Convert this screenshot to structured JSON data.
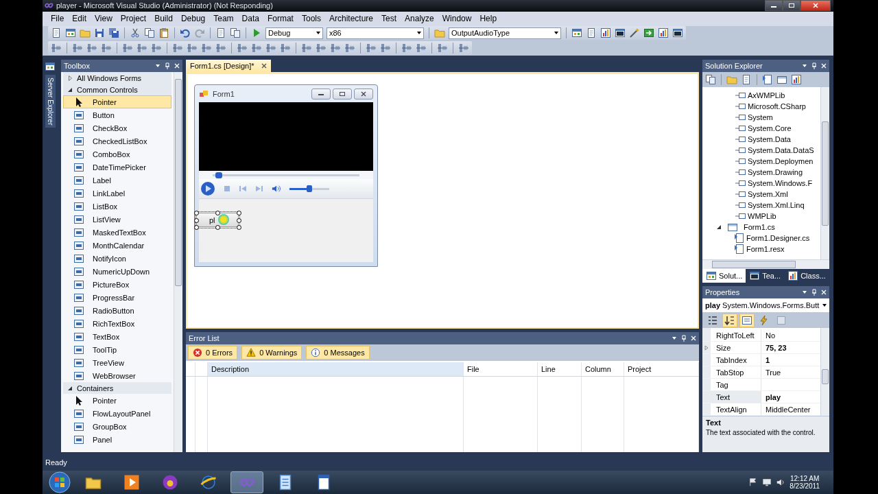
{
  "window": {
    "title": "player - Microsoft Visual Studio (Administrator) (Not Responding)"
  },
  "menu": [
    "File",
    "Edit",
    "View",
    "Project",
    "Build",
    "Debug",
    "Team",
    "Data",
    "Format",
    "Tools",
    "Architecture",
    "Test",
    "Analyze",
    "Window",
    "Help"
  ],
  "toolbar": {
    "configuration": "Debug",
    "platform": "x86",
    "find": "OutputAudioType"
  },
  "server_explorer": {
    "label": "Server Explorer"
  },
  "toolbox": {
    "title": "Toolbox",
    "groups": [
      {
        "label": "All Windows Forms",
        "expanded": false
      },
      {
        "label": "Common Controls",
        "expanded": true,
        "items": [
          {
            "label": "Pointer",
            "kind": "pointer",
            "selected": true
          },
          {
            "label": "Button",
            "kind": "control",
            "selected": false
          },
          {
            "label": "CheckBox",
            "kind": "control",
            "selected": false
          },
          {
            "label": "CheckedListBox",
            "kind": "control",
            "selected": false
          },
          {
            "label": "ComboBox",
            "kind": "control",
            "selected": false
          },
          {
            "label": "DateTimePicker",
            "kind": "control",
            "selected": false
          },
          {
            "label": "Label",
            "kind": "control",
            "selected": false
          },
          {
            "label": "LinkLabel",
            "kind": "control",
            "selected": false
          },
          {
            "label": "ListBox",
            "kind": "control",
            "selected": false
          },
          {
            "label": "ListView",
            "kind": "control",
            "selected": false
          },
          {
            "label": "MaskedTextBox",
            "kind": "control",
            "selected": false
          },
          {
            "label": "MonthCalendar",
            "kind": "control",
            "selected": false
          },
          {
            "label": "NotifyIcon",
            "kind": "control",
            "selected": false
          },
          {
            "label": "NumericUpDown",
            "kind": "control",
            "selected": false
          },
          {
            "label": "PictureBox",
            "kind": "control",
            "selected": false
          },
          {
            "label": "ProgressBar",
            "kind": "control",
            "selected": false
          },
          {
            "label": "RadioButton",
            "kind": "control",
            "selected": false
          },
          {
            "label": "RichTextBox",
            "kind": "control",
            "selected": false
          },
          {
            "label": "TextBox",
            "kind": "control",
            "selected": false
          },
          {
            "label": "ToolTip",
            "kind": "control",
            "selected": false
          },
          {
            "label": "TreeView",
            "kind": "control",
            "selected": false
          },
          {
            "label": "WebBrowser",
            "kind": "control",
            "selected": false
          }
        ]
      },
      {
        "label": "Containers",
        "expanded": true,
        "items": [
          {
            "label": "Pointer",
            "kind": "pointer",
            "selected": false
          },
          {
            "label": "FlowLayoutPanel",
            "kind": "control",
            "selected": false
          },
          {
            "label": "GroupBox",
            "kind": "control",
            "selected": false
          },
          {
            "label": "Panel",
            "kind": "control",
            "selected": false
          }
        ]
      }
    ]
  },
  "document_tab": {
    "label": "Form1.cs [Design]*",
    "selected": true
  },
  "form": {
    "title": "Form1",
    "player": {
      "seek": {
        "level": 0.04
      },
      "volume": {
        "level": 0.5
      }
    },
    "button": {
      "text": "pl",
      "selected": true
    }
  },
  "error_list": {
    "title": "Error List",
    "filters": [
      {
        "label": "0 Errors",
        "kind": "error",
        "selected": true
      },
      {
        "label": "0 Warnings",
        "kind": "warning",
        "selected": true
      },
      {
        "label": "0 Messages",
        "kind": "info",
        "selected": true
      }
    ],
    "columns": [
      "Description",
      "File",
      "Line",
      "Column",
      "Project"
    ]
  },
  "solution_explorer": {
    "title": "Solution Explorer",
    "references": [
      "AxWMPLib",
      "Microsoft.CSharp",
      "System",
      "System.Core",
      "System.Data",
      "System.Data.DataS",
      "System.Deploymen",
      "System.Drawing",
      "System.Windows.F",
      "System.Xml",
      "System.Xml.Linq",
      "WMPLib"
    ],
    "files": [
      {
        "label": "Form1.cs",
        "expanded": true,
        "children": [
          {
            "label": "Form1.Designer.cs"
          },
          {
            "label": "Form1.resx"
          }
        ]
      }
    ],
    "tabs": [
      {
        "label": "Solut...",
        "selected": true
      },
      {
        "label": "Tea...",
        "selected": false
      },
      {
        "label": "Class...",
        "selected": false
      }
    ]
  },
  "properties": {
    "title": "Properties",
    "object_name": "play",
    "object_type": "System.Windows.Forms.Butt",
    "toolbar": [
      {
        "selected": false
      },
      {
        "selected": true
      },
      {
        "selected": true
      },
      {
        "selected": false
      },
      {
        "selected": false
      }
    ],
    "rows": [
      {
        "name": "RightToLeft",
        "value": "No",
        "expandable": false,
        "modified": false,
        "selected": false
      },
      {
        "name": "Size",
        "value": "75, 23",
        "expandable": true,
        "modified": true,
        "selected": false
      },
      {
        "name": "TabIndex",
        "value": "1",
        "expandable": false,
        "modified": true,
        "selected": false
      },
      {
        "name": "TabStop",
        "value": "True",
        "expandable": false,
        "modified": false,
        "selected": false
      },
      {
        "name": "Tag",
        "expandable": false,
        "selected": false
      },
      {
        "name": "Text",
        "value": "play",
        "expandable": false,
        "modified": true,
        "selected": true
      },
      {
        "name": "TextAlign",
        "value": "MiddleCenter",
        "expandable": false,
        "modified": false,
        "selected": false
      }
    ],
    "description": {
      "title": "Text",
      "text": "The text associated with the control."
    }
  },
  "status_bar": {
    "text": "Ready"
  },
  "taskbar": {
    "apps": [
      {
        "selected": false
      },
      {
        "selected": false
      },
      {
        "selected": false
      },
      {
        "selected": false
      },
      {
        "selected": true
      },
      {
        "selected": false
      },
      {
        "selected": false
      }
    ],
    "time": "12:12 AM",
    "date": "8/23/2011"
  }
}
